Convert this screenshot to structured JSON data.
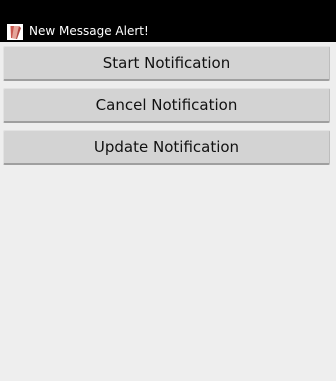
{
  "app": {
    "title": "New Message Alert!",
    "icon": "app-icon"
  },
  "buttons": {
    "start": "Start Notification",
    "cancel": "Cancel Notification",
    "update": "Update Notification"
  },
  "colors": {
    "bars": "#000000",
    "background": "#eeeeee",
    "button": "#d3d3d3",
    "button_text": "#111111"
  }
}
